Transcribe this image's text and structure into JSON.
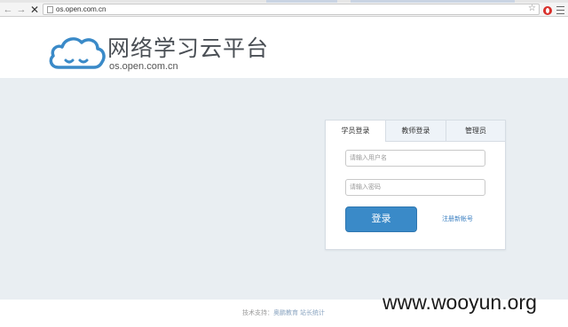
{
  "browser": {
    "url": "os.open.com.cn",
    "back_icon": "arrow-left-icon",
    "forward_icon": "arrow-right-icon",
    "stop_icon": "close-icon",
    "bookmark_icon": "star-icon",
    "menu_icon": "menu-icon",
    "back_glyph": "←",
    "forward_glyph": "→",
    "stop_glyph": "✕",
    "star_glyph": "☆"
  },
  "header": {
    "title": "网络学习云平台",
    "subtitle": "os.open.com.cn",
    "logo_icon": "cloud-logo-icon",
    "brand_color": "#3a8ac8"
  },
  "login": {
    "tabs": [
      {
        "label": "学员登录",
        "active": true
      },
      {
        "label": "教师登录",
        "active": false
      },
      {
        "label": "管理员",
        "active": false
      }
    ],
    "username_placeholder": "请输入用户名",
    "password_placeholder": "请输入密码",
    "submit_label": "登录",
    "register_label": "注册新帐号"
  },
  "footer": {
    "prefix": "技术支持：",
    "link1": "奥鹏教育",
    "link2": "站长统计"
  },
  "watermark": "www.wooyun.org",
  "colors": {
    "page_bg": "#e9eef2",
    "button": "#3a8ac8",
    "link": "#3a7fc1"
  }
}
